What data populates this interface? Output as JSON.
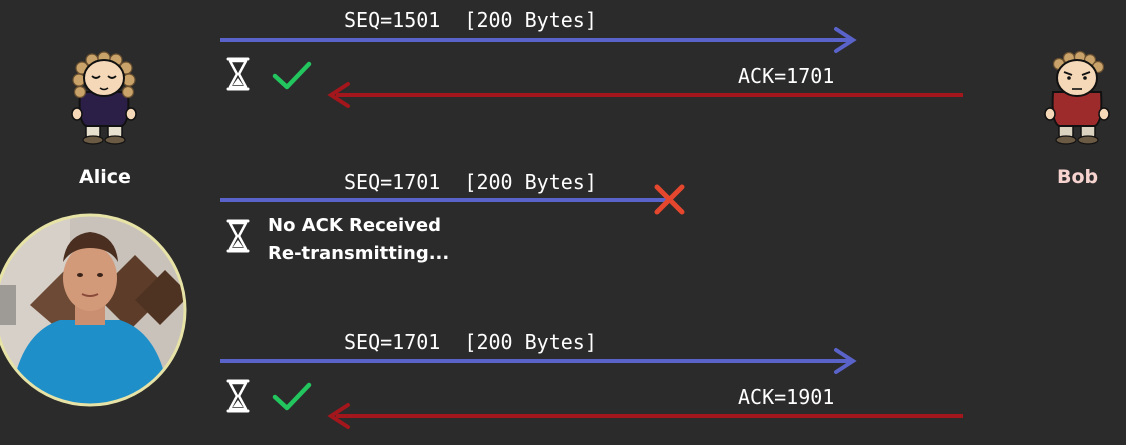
{
  "participants": {
    "left": {
      "name": "Alice"
    },
    "right": {
      "name": "Bob"
    }
  },
  "exchanges": [
    {
      "segment_label": "SEQ=1501  [200 Bytes]",
      "ack_label": "ACK=1701",
      "outcome": "acknowledged"
    },
    {
      "segment_label": "SEQ=1701  [200 Bytes]",
      "ack_label": "",
      "outcome": "lost",
      "note_line1": "No ACK Received",
      "note_line2": "Re-transmitting..."
    },
    {
      "segment_label": "SEQ=1701  [200 Bytes]",
      "ack_label": "ACK=1901",
      "outcome": "acknowledged"
    }
  ],
  "colors": {
    "background": "#2b2b2b",
    "send_arrow": "#5a63c9",
    "ack_arrow": "#a3161b",
    "check": "#22c55e",
    "lost_x": "#e4472d",
    "alice_label": "#ffffff",
    "bob_label": "#f7d3d0"
  },
  "icons": [
    "hourglass-icon",
    "checkmark-icon",
    "x-mark-icon",
    "alice-avatar",
    "bob-avatar",
    "presenter-webcam"
  ]
}
